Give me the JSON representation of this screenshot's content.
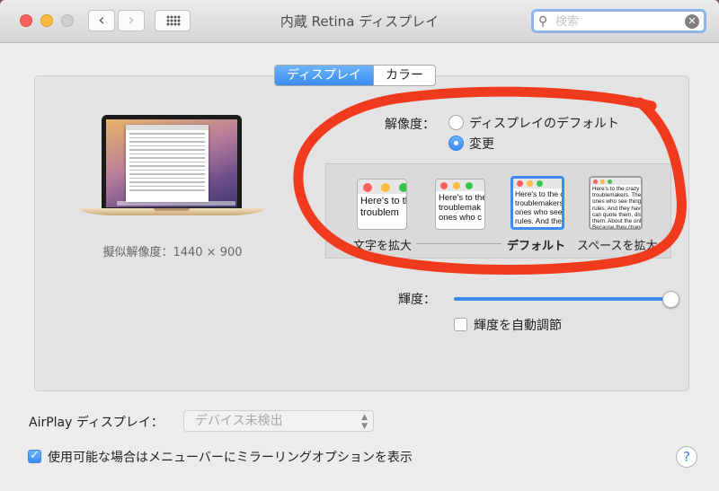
{
  "window": {
    "title": "内蔵 Retina ディスプレイ",
    "nav_back": "‹",
    "nav_forward": "›"
  },
  "search": {
    "placeholder": "検索",
    "value": ""
  },
  "tabs": [
    {
      "label": "ディスプレイ",
      "active": true
    },
    {
      "label": "カラー",
      "active": false
    }
  ],
  "display": {
    "virtual_resolution": "擬似解像度：1440 × 900",
    "resolution_label": "解像度：",
    "options": [
      {
        "label": "ディスプレイのデフォルト",
        "selected": false
      },
      {
        "label": "変更",
        "selected": true
      }
    ],
    "scales": [
      {
        "label": "文字を拡大",
        "preview": "Here's to the\ntroublem",
        "selected": false
      },
      {
        "label": "",
        "preview": "Here's to the\ntroublemak\nones who c",
        "selected": false
      },
      {
        "label": "デフォルト",
        "preview": "Here's to the cr\ntroublemakers.\nones who see t\nrules. And they",
        "selected": true
      },
      {
        "label": "スペースを拡大",
        "preview": "Here's to the crazy ones\ntroublemakers. The rou\nones who see things di\nrules. And they have no\ncan quote them, disagre\nthem. About the only th\nBecause they change th",
        "selected": false
      }
    ],
    "brightness_label": "輝度：",
    "brightness_level": 1.0,
    "auto_brightness_label": "輝度を自動調節",
    "auto_brightness_checked": false
  },
  "airplay": {
    "label": "AirPlay ディスプレイ：",
    "selected": "デバイス未検出"
  },
  "mirroring": {
    "label": "使用可能な場合はメニューバーにミラーリングオプションを表示",
    "checked": true
  },
  "help_label": "?",
  "colors": {
    "accent": "#3b8cf3",
    "annotation": "#f03a1e"
  }
}
